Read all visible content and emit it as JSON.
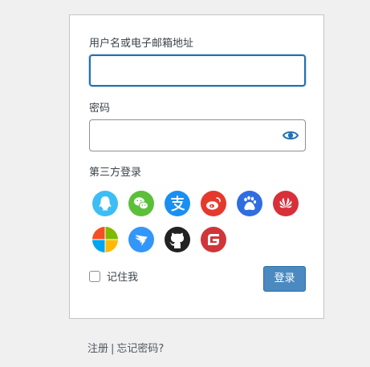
{
  "form": {
    "username_label": "用户名或电子邮箱地址",
    "username_value": "",
    "password_label": "密码",
    "password_value": "",
    "social_label": "第三方登录",
    "remember_label": "记住我",
    "login_button": "登录"
  },
  "social_icons": [
    {
      "name": "qq-icon",
      "color": "#3dbdf5"
    },
    {
      "name": "wechat-icon",
      "color": "#5cbf3a"
    },
    {
      "name": "alipay-icon",
      "color": "#1a8ff2"
    },
    {
      "name": "weibo-icon",
      "color": "#e5392b"
    },
    {
      "name": "baidu-icon",
      "color": "#2f6de0"
    },
    {
      "name": "huawei-icon",
      "color": "#d8303a"
    },
    {
      "name": "microsoft-icon",
      "color": "#f25022"
    },
    {
      "name": "dingtalk-icon",
      "color": "#3296fa"
    },
    {
      "name": "github-icon",
      "color": "#222222"
    },
    {
      "name": "gitee-icon",
      "color": "#d0353a"
    }
  ],
  "links": {
    "register": "注册",
    "separator": "|",
    "forgot_password": "忘记密码?"
  },
  "colors": {
    "accent": "#2271b1",
    "button": "#4a8ac0"
  }
}
